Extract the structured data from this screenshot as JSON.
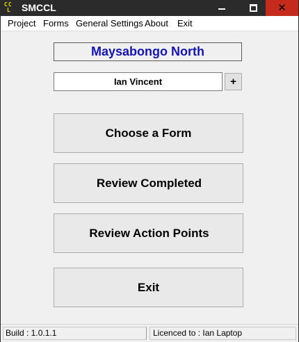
{
  "window": {
    "title": "SMCCL",
    "icon_letters_top": "CC",
    "icon_letters_bottom": "L",
    "controls": {
      "minimize_icon": "minimize-icon",
      "maximize_icon": "maximize-icon",
      "close_icon": "close-icon",
      "close_glyph": "✕"
    }
  },
  "menu": {
    "items": [
      {
        "label": "Project"
      },
      {
        "label": "Forms"
      },
      {
        "label": "General Settings"
      },
      {
        "label": "About"
      },
      {
        "label": "Exit"
      }
    ]
  },
  "main": {
    "project_name": "Maysabongo North",
    "user_name": "Ian Vincent",
    "add_user_label": "+",
    "buttons": {
      "choose_form": "Choose a Form",
      "review_completed": "Review Completed",
      "review_action_points": "Review Action Points",
      "exit": "Exit"
    }
  },
  "status": {
    "build": "Build : 1.0.1.1",
    "licence": "Licenced to : Ian Laptop"
  },
  "colors": {
    "titlebar_bg": "#2b2b2b",
    "close_bg": "#c42b1c",
    "project_text": "#1414b8",
    "icon_letters": "#e8e000"
  }
}
